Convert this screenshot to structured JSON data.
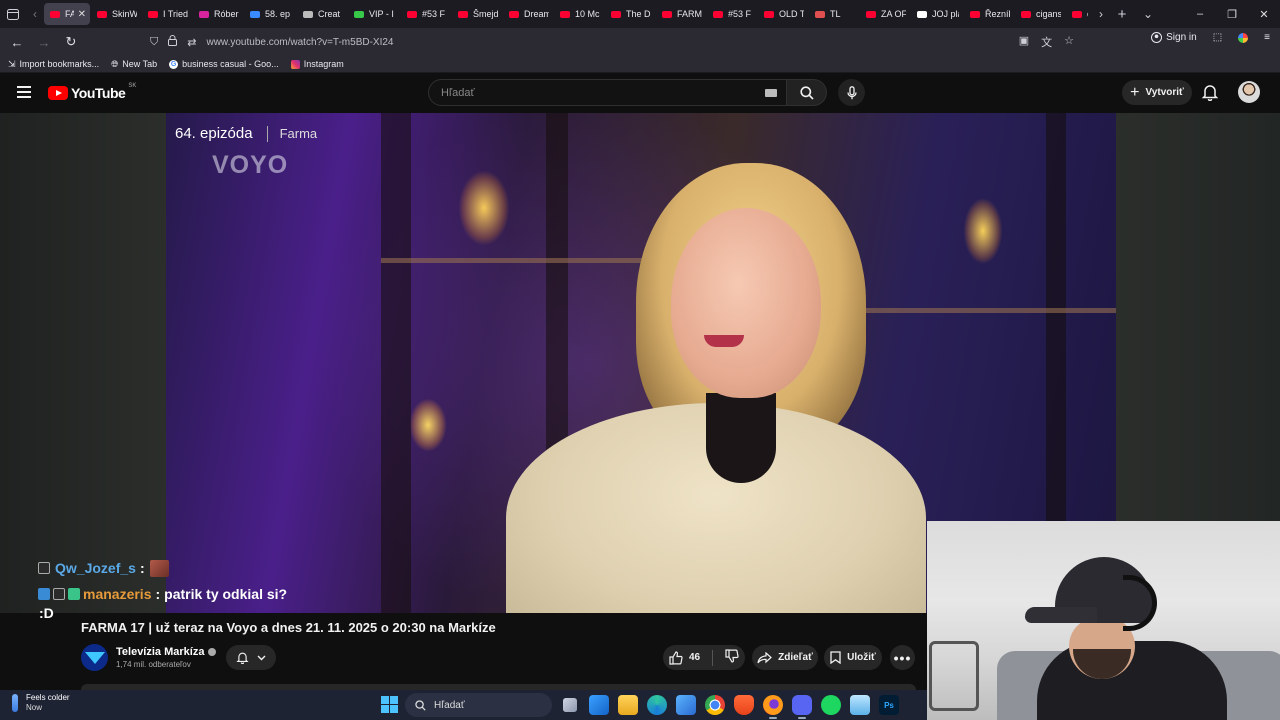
{
  "browser": {
    "tabs": [
      {
        "label": "FAR",
        "color": "#ff0033",
        "active": true
      },
      {
        "label": "SkinW",
        "color": "#ff0033"
      },
      {
        "label": "I Tried",
        "color": "#ff0033"
      },
      {
        "label": "Róber",
        "color": "#d6249f"
      },
      {
        "label": "58. ep",
        "color": "#3a8bff"
      },
      {
        "label": "Creat",
        "color": "#bbbbbb"
      },
      {
        "label": "VIP - I",
        "color": "#37c84a"
      },
      {
        "label": "#53 F",
        "color": "#ff0033"
      },
      {
        "label": "Šmejd",
        "color": "#ff0033"
      },
      {
        "label": "Dream",
        "color": "#ff0033"
      },
      {
        "label": "10 Mc",
        "color": "#ff0033"
      },
      {
        "label": "The D",
        "color": "#ff0033"
      },
      {
        "label": "FARM",
        "color": "#ff0033"
      },
      {
        "label": "#53 F",
        "color": "#ff0033"
      },
      {
        "label": "OLD T",
        "color": "#ff0033"
      },
      {
        "label": "TL",
        "color": "#e05050"
      },
      {
        "label": "ZA OF",
        "color": "#ff0033"
      },
      {
        "label": "JOJ play",
        "color": "#ffffff"
      },
      {
        "label": "Řezník",
        "color": "#ff0033"
      },
      {
        "label": "cigans",
        "color": "#ff0033"
      },
      {
        "label": "co",
        "color": "#ff0033"
      }
    ],
    "url": "www.youtube.com/watch?v=T-m5BD-XI24",
    "sign_in": "Sign in",
    "bookmarks": [
      {
        "label": "Import bookmarks...",
        "icon": "import-icon"
      },
      {
        "label": "New Tab",
        "icon": "globe-icon"
      },
      {
        "label": "business casual - Goo...",
        "icon": "google-icon"
      },
      {
        "label": "Instagram",
        "icon": "instagram-icon"
      }
    ]
  },
  "youtube": {
    "logo_text": "YouTube",
    "country_code": "SK",
    "search_placeholder": "Hľadať",
    "create_label": "Vytvoriť"
  },
  "video": {
    "episode": "64. epizóda",
    "show": "Farma",
    "watermark": "VOYO",
    "title": "FARMA 17 | už teraz na Voyo a dnes 21. 11. 2025 o 20:30 na Markíze"
  },
  "chat": [
    {
      "user": "Qw_Jozef_s",
      "message": ""
    },
    {
      "user": "manazeris",
      "message": "patrik ty odkial si?"
    }
  ],
  "chat_continuation": ":D",
  "channel": {
    "name": "Televízia Markíza",
    "subscribers": "1,74 mil. odberateľov"
  },
  "actions": {
    "likes": "46",
    "share_label": "Zdieľať",
    "save_label": "Uložiť"
  },
  "taskbar": {
    "weather_title": "Feels colder",
    "weather_sub": "Now",
    "search_placeholder": "Hľadať"
  }
}
